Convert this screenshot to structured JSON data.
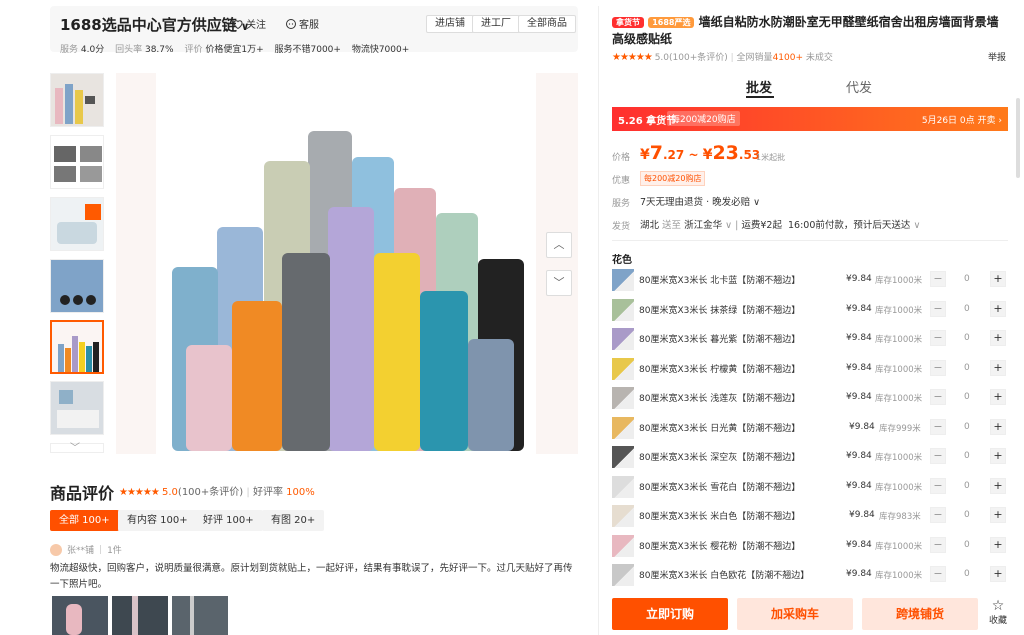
{
  "store": {
    "name": "1688选品中心官方供应链",
    "follow": "关注",
    "service": "客服",
    "buttons": [
      "进店铺",
      "进工厂",
      "全部商品"
    ],
    "stats": [
      {
        "k": "服务",
        "v": "4.0分"
      },
      {
        "k": "回头率",
        "v": "38.7%"
      },
      {
        "k": "评价",
        "v": "价格便宜1万+"
      },
      {
        "k": "",
        "v": "服务不错7000+"
      },
      {
        "k": "",
        "v": "物流快7000+"
      }
    ]
  },
  "reviews": {
    "title": "商品评价",
    "score": "5.0",
    "count": "(100+条评价)",
    "good_label": "好评率",
    "good_rate": "100%",
    "chips": [
      "全部 100+",
      "有内容 100+",
      "好评 100+",
      "有图 20+"
    ],
    "reviewer": "张**铺",
    "reviewer_qty": "1件",
    "text": "物流超级快，回购客户，说明质量很满意。原计划到货就贴上，一起好评，结果有事耽误了，先好评一下。过几天贴好了再传一下照片吧。"
  },
  "product": {
    "badge1": "拿货节",
    "badge2": "1688严选",
    "title": "墙纸自粘防水防潮卧室无甲醛壁纸宿舍出租房墙面背景墙高级感贴纸",
    "rating": "5.0(100+条评价)",
    "sales_label": "全网销量",
    "sales": "4100+",
    "sales_suffix": "未成交",
    "report": "举报",
    "tabs": [
      "批发",
      "代发"
    ],
    "promo_title": "5.26 拿货节",
    "promo_coupon": "每200减20购店",
    "promo_time": "5月26日 0点 开卖",
    "price_label": "价格",
    "price_low_int": "7",
    "price_low_dec": ".27",
    "price_high_int": "23",
    "price_high_dec": ".53",
    "currency": "¥",
    "tilde": "~",
    "min_buy": "1米起批",
    "coupon_label": "优惠",
    "coupon": "每200减20购店",
    "service_label": "服务",
    "service": "7天无理由退货 · 晚发必赔",
    "ship_label": "发货",
    "ship_from": "湖北",
    "ship_to_word": "送至",
    "ship_to": "浙江金华",
    "freight": "运费¥2起",
    "ship_time": "16:00前付款，预计后天送达",
    "flower_label": "花色"
  },
  "skus": [
    {
      "name": "80厘米宽X3米长 北卡蓝【防潮不翘边】",
      "price": "¥9.84",
      "stock": "库存1000米",
      "qty": "0",
      "color": "#7fa3c8"
    },
    {
      "name": "80厘米宽X3米长 抹茶绿【防潮不翘边】",
      "price": "¥9.84",
      "stock": "库存1000米",
      "qty": "0",
      "color": "#a8c09a"
    },
    {
      "name": "80厘米宽X3米长 暮光紫【防潮不翘边】",
      "price": "¥9.84",
      "stock": "库存1000米",
      "qty": "0",
      "color": "#a99ac8"
    },
    {
      "name": "80厘米宽X3米长 柠檬黄【防潮不翘边】",
      "price": "¥9.84",
      "stock": "库存1000米",
      "qty": "0",
      "color": "#e8c84a"
    },
    {
      "name": "80厘米宽X3米长 浅莲灰【防潮不翘边】",
      "price": "¥9.84",
      "stock": "库存1000米",
      "qty": "0",
      "color": "#b8b4b0"
    },
    {
      "name": "80厘米宽X3米长 日光黄【防潮不翘边】",
      "price": "¥9.84",
      "stock": "库存999米",
      "qty": "0",
      "color": "#e8b860"
    },
    {
      "name": "80厘米宽X3米长 深空灰【防潮不翘边】",
      "price": "¥9.84",
      "stock": "库存1000米",
      "qty": "0",
      "color": "#555"
    },
    {
      "name": "80厘米宽X3米长 雪花白【防潮不翘边】",
      "price": "¥9.84",
      "stock": "库存1000米",
      "qty": "0",
      "color": "#ddd"
    },
    {
      "name": "80厘米宽X3米长 米白色【防潮不翘边】",
      "price": "¥9.84",
      "stock": "库存983米",
      "qty": "0",
      "color": "#e6ddd0"
    },
    {
      "name": "80厘米宽X3米长 樱花粉【防潮不翘边】",
      "price": "¥9.84",
      "stock": "库存1000米",
      "qty": "0",
      "color": "#e8b8c0"
    },
    {
      "name": "80厘米宽X3米长 白色欧花【防潮不翘边】",
      "price": "¥9.84",
      "stock": "库存1000米",
      "qty": "0",
      "color": "#c8c8c8"
    }
  ],
  "actions": {
    "buy": "立即订购",
    "cart": "加采购车",
    "cross": "跨境铺货",
    "fav": "收藏"
  },
  "colors": {
    "accent": "#ff5000",
    "promo_start": "#ff2f2f",
    "promo_end": "#ff7a1a"
  }
}
